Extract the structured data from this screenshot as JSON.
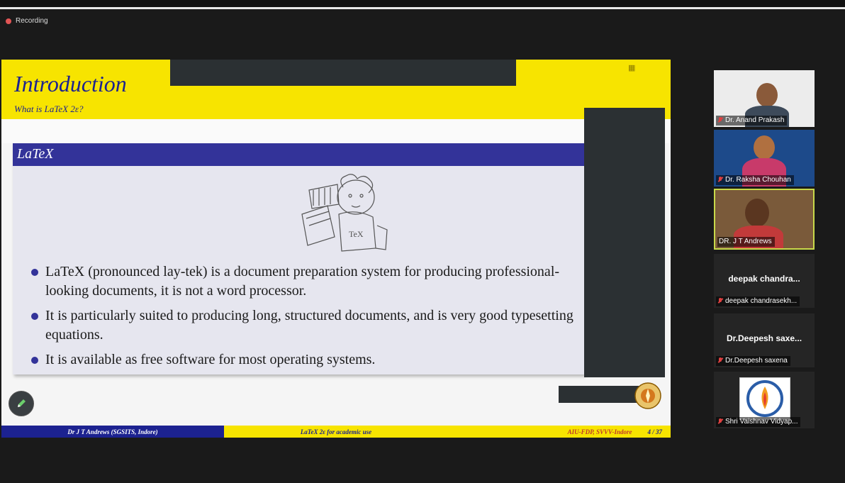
{
  "recording": {
    "label": "Recording"
  },
  "slide": {
    "title": "Introduction",
    "subtitle": "What is LaTeX 2ε?",
    "block_title": "LaTeX",
    "bullets": [
      "LaTeX (pronounced lay-tek) is a document preparation system for producing professional-looking documents, it is not a word processor.",
      "It is particularly suited to producing long, structured documents, and is very good typesetting equations.",
      "It is available as free software for most operating systems."
    ],
    "footer": {
      "author": "Dr J T Andrews (SGSITS, Indore)",
      "topic": "LaTeX 2ε for academic use",
      "event": "AIU-FDP, SVVV-Indore",
      "page": "4 / 37"
    },
    "colors": {
      "yellow": "#f7e400",
      "blue": "#333399",
      "navy": "#1c2290"
    }
  },
  "participants": [
    {
      "name": "Dr. Anand Prakash",
      "muted": true,
      "type": "video"
    },
    {
      "name": "Dr. Raksha Chouhan",
      "muted": true,
      "type": "video"
    },
    {
      "name": "DR. J T Andrews",
      "muted": false,
      "type": "video",
      "active_speaker": true
    },
    {
      "display": "deepak chandra...",
      "name": "deepak chandrasekh...",
      "muted": true,
      "type": "avatar"
    },
    {
      "display": "Dr.Deepesh saxe...",
      "name": "Dr.Deepesh saxena",
      "muted": true,
      "type": "avatar"
    },
    {
      "name": "Shri Vaishnav Vidyap...",
      "muted": true,
      "type": "logo"
    }
  ],
  "icons": {
    "annotate": "pencil-icon",
    "mic": "mic-muted-icon",
    "record": "record-dot-icon"
  }
}
